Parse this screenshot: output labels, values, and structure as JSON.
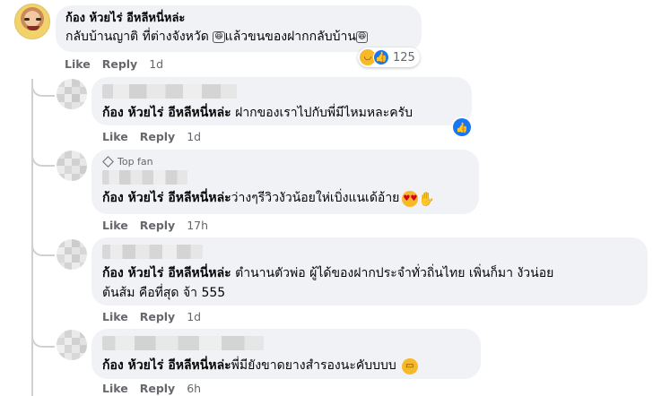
{
  "comments": [
    {
      "author": "ก้อง ห้วยไร่ อีหลีหนี่หล่ะ",
      "text_parts": [
        "กลับบ้านญาติ ที่ต่างจังหวัด ",
        "แล้วขนของฝากกลับบ้าน"
      ],
      "inline_emoji": "😆",
      "like": "Like",
      "reply": "Reply",
      "time": "1d",
      "reaction_count": "125",
      "reactions": [
        "laugh-emoji",
        "like-emoji"
      ]
    },
    {
      "mention": "ก้อง ห้วยไร่ อีหลีหนี่หล่ะ",
      "text": " ฝากของเราไปกับพี่มีไหมหละครับ",
      "like": "Like",
      "reply": "Reply",
      "time": "1d",
      "reactions": [
        "like-emoji"
      ]
    },
    {
      "badge": "Top fan",
      "mention": "ก้อง ห้วยไร่ อีหลีหนี่หล่ะ",
      "text": " ว่างๆรีวิวงัวน้อยให่เบิ่งแนเด้อ้าย",
      "like": "Like",
      "reply": "Reply",
      "time": "17h",
      "reactions": [
        "heart-eyes-emoji",
        "clapping-hands-emoji"
      ]
    },
    {
      "mention": "ก้อง ห้วยไร่ อีหลีหนี่หล่ะ",
      "text_line1": " ตำนานตัวพ่อ ผู้ได้ของฝากประจำทั่วถิ่นไทย เพิ่นก็มา งัวน่อย",
      "text_line2": "ต้นส้ม คือที่สุด จ้า 555",
      "like": "Like",
      "reply": "Reply",
      "time": "1d"
    },
    {
      "mention": "ก้อง ห้วยไร่ อีหลีหนี่หล่ะ",
      "text": " พี่มียังขาดยางสำรองนะคับบบบ",
      "like": "Like",
      "reply": "Reply",
      "time": "6h",
      "reactions": [
        "grimace-emoji"
      ]
    }
  ]
}
